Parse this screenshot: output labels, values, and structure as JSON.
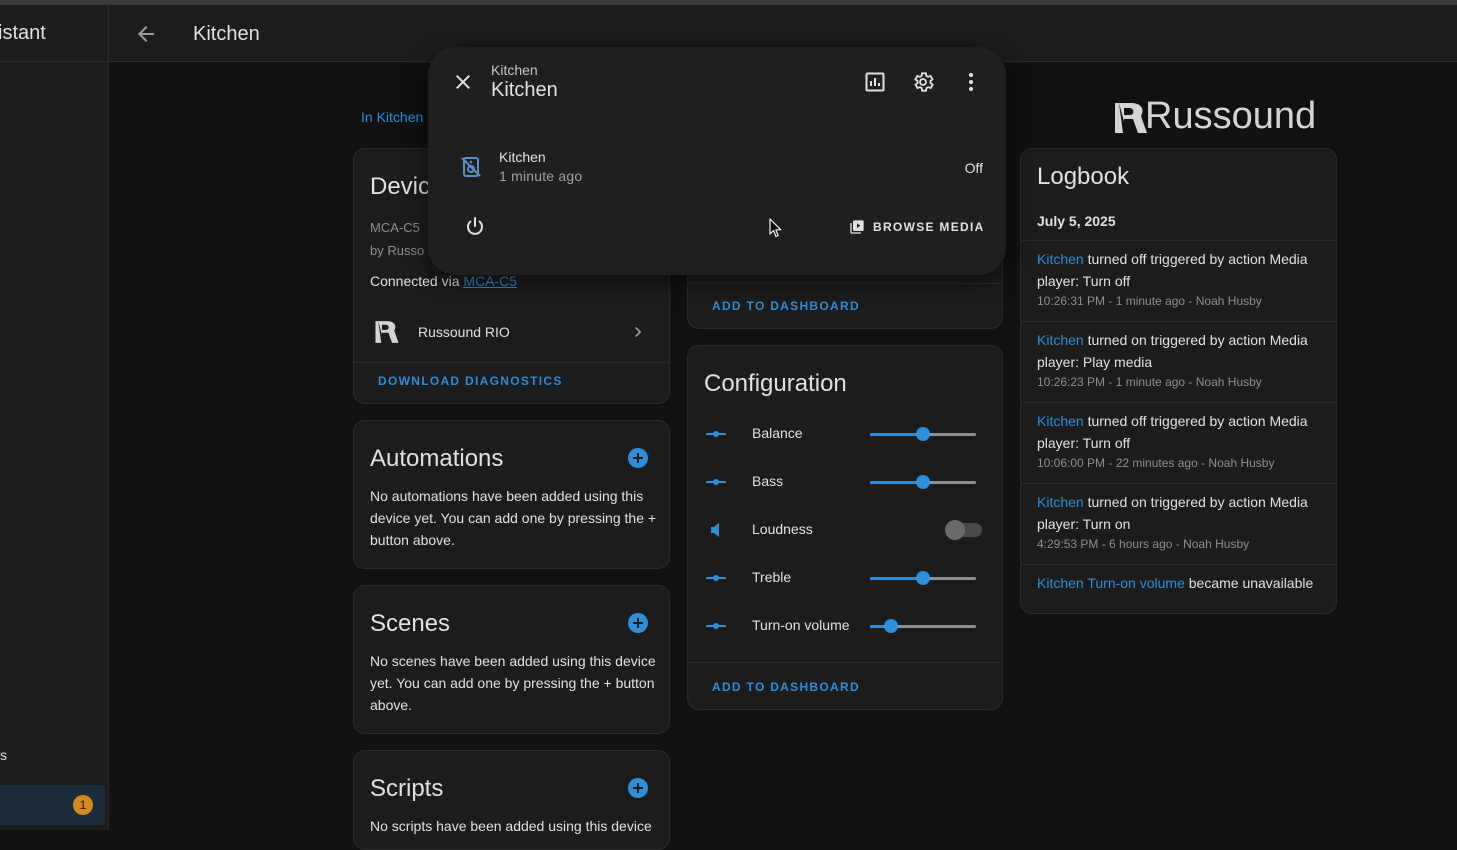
{
  "sidebar": {
    "app_title": "istant",
    "partial_item": "s",
    "notification_count": "1"
  },
  "header": {
    "title": "Kitchen"
  },
  "area_link": "In Kitchen",
  "brand": {
    "logo_text": "Russound"
  },
  "device_card": {
    "title": "Devic",
    "model": "MCA-C5",
    "manufacturer": "by Russo",
    "connected_via_label": "Connected via",
    "connected_via_link": "MCA-C5",
    "integration_name": "Russound RIO",
    "download_diagnostics": "DOWNLOAD DIAGNOSTICS"
  },
  "automations": {
    "title": "Automations",
    "text": "No automations have been added using this device yet. You can add one by pressing the + button above."
  },
  "scenes": {
    "title": "Scenes",
    "text": "No scenes have been added using this device yet. You can add one by pressing the + button above."
  },
  "scripts": {
    "title": "Scripts",
    "text": "No scripts have been added using this device"
  },
  "controls_card": {
    "add_to_dashboard": "ADD TO DASHBOARD"
  },
  "configuration": {
    "title": "Configuration",
    "items": [
      {
        "label": "Balance",
        "type": "slider",
        "value": 0.5
      },
      {
        "label": "Bass",
        "type": "slider",
        "value": 0.5
      },
      {
        "label": "Loudness",
        "type": "toggle",
        "value": false
      },
      {
        "label": "Treble",
        "type": "slider",
        "value": 0.5
      },
      {
        "label": "Turn-on volume",
        "type": "slider",
        "value": 0.2
      }
    ],
    "add_to_dashboard": "ADD TO DASHBOARD"
  },
  "logbook": {
    "title": "Logbook",
    "date": "July 5, 2025",
    "entries": [
      {
        "entity": "Kitchen",
        "text": " turned off triggered by action Media player: Turn off",
        "meta": "10:26:31 PM - 1 minute ago - Noah Husby"
      },
      {
        "entity": "Kitchen",
        "text": " turned on triggered by action Media player: Play media",
        "meta": "10:26:23 PM - 1 minute ago - Noah Husby"
      },
      {
        "entity": "Kitchen",
        "text": " turned off triggered by action Media player: Turn off",
        "meta": "10:06:00 PM - 22 minutes ago - Noah Husby"
      },
      {
        "entity": "Kitchen",
        "text": " turned on triggered by action Media player: Turn on",
        "meta": "4:29:53 PM - 6 hours ago - Noah Husby"
      },
      {
        "entity": "Kitchen Turn-on volume",
        "text": " became unavailable",
        "meta": ""
      }
    ]
  },
  "dialog": {
    "subtitle": "Kitchen",
    "title": "Kitchen",
    "entity_name": "Kitchen",
    "entity_time": "1 minute ago",
    "entity_state": "Off",
    "browse_media": "BROWSE MEDIA"
  },
  "icons": {
    "back": "arrow-left-icon",
    "close": "close-icon",
    "history": "chart-icon",
    "settings": "gear-icon",
    "more": "dots-vertical-icon",
    "entity": "speaker-off-icon",
    "power": "power-icon",
    "browse": "media-library-icon"
  },
  "colors": {
    "accent": "#2f8ed8",
    "badge": "#d58b1c",
    "card_bg": "#1c1c1c",
    "page_bg": "#111111"
  }
}
